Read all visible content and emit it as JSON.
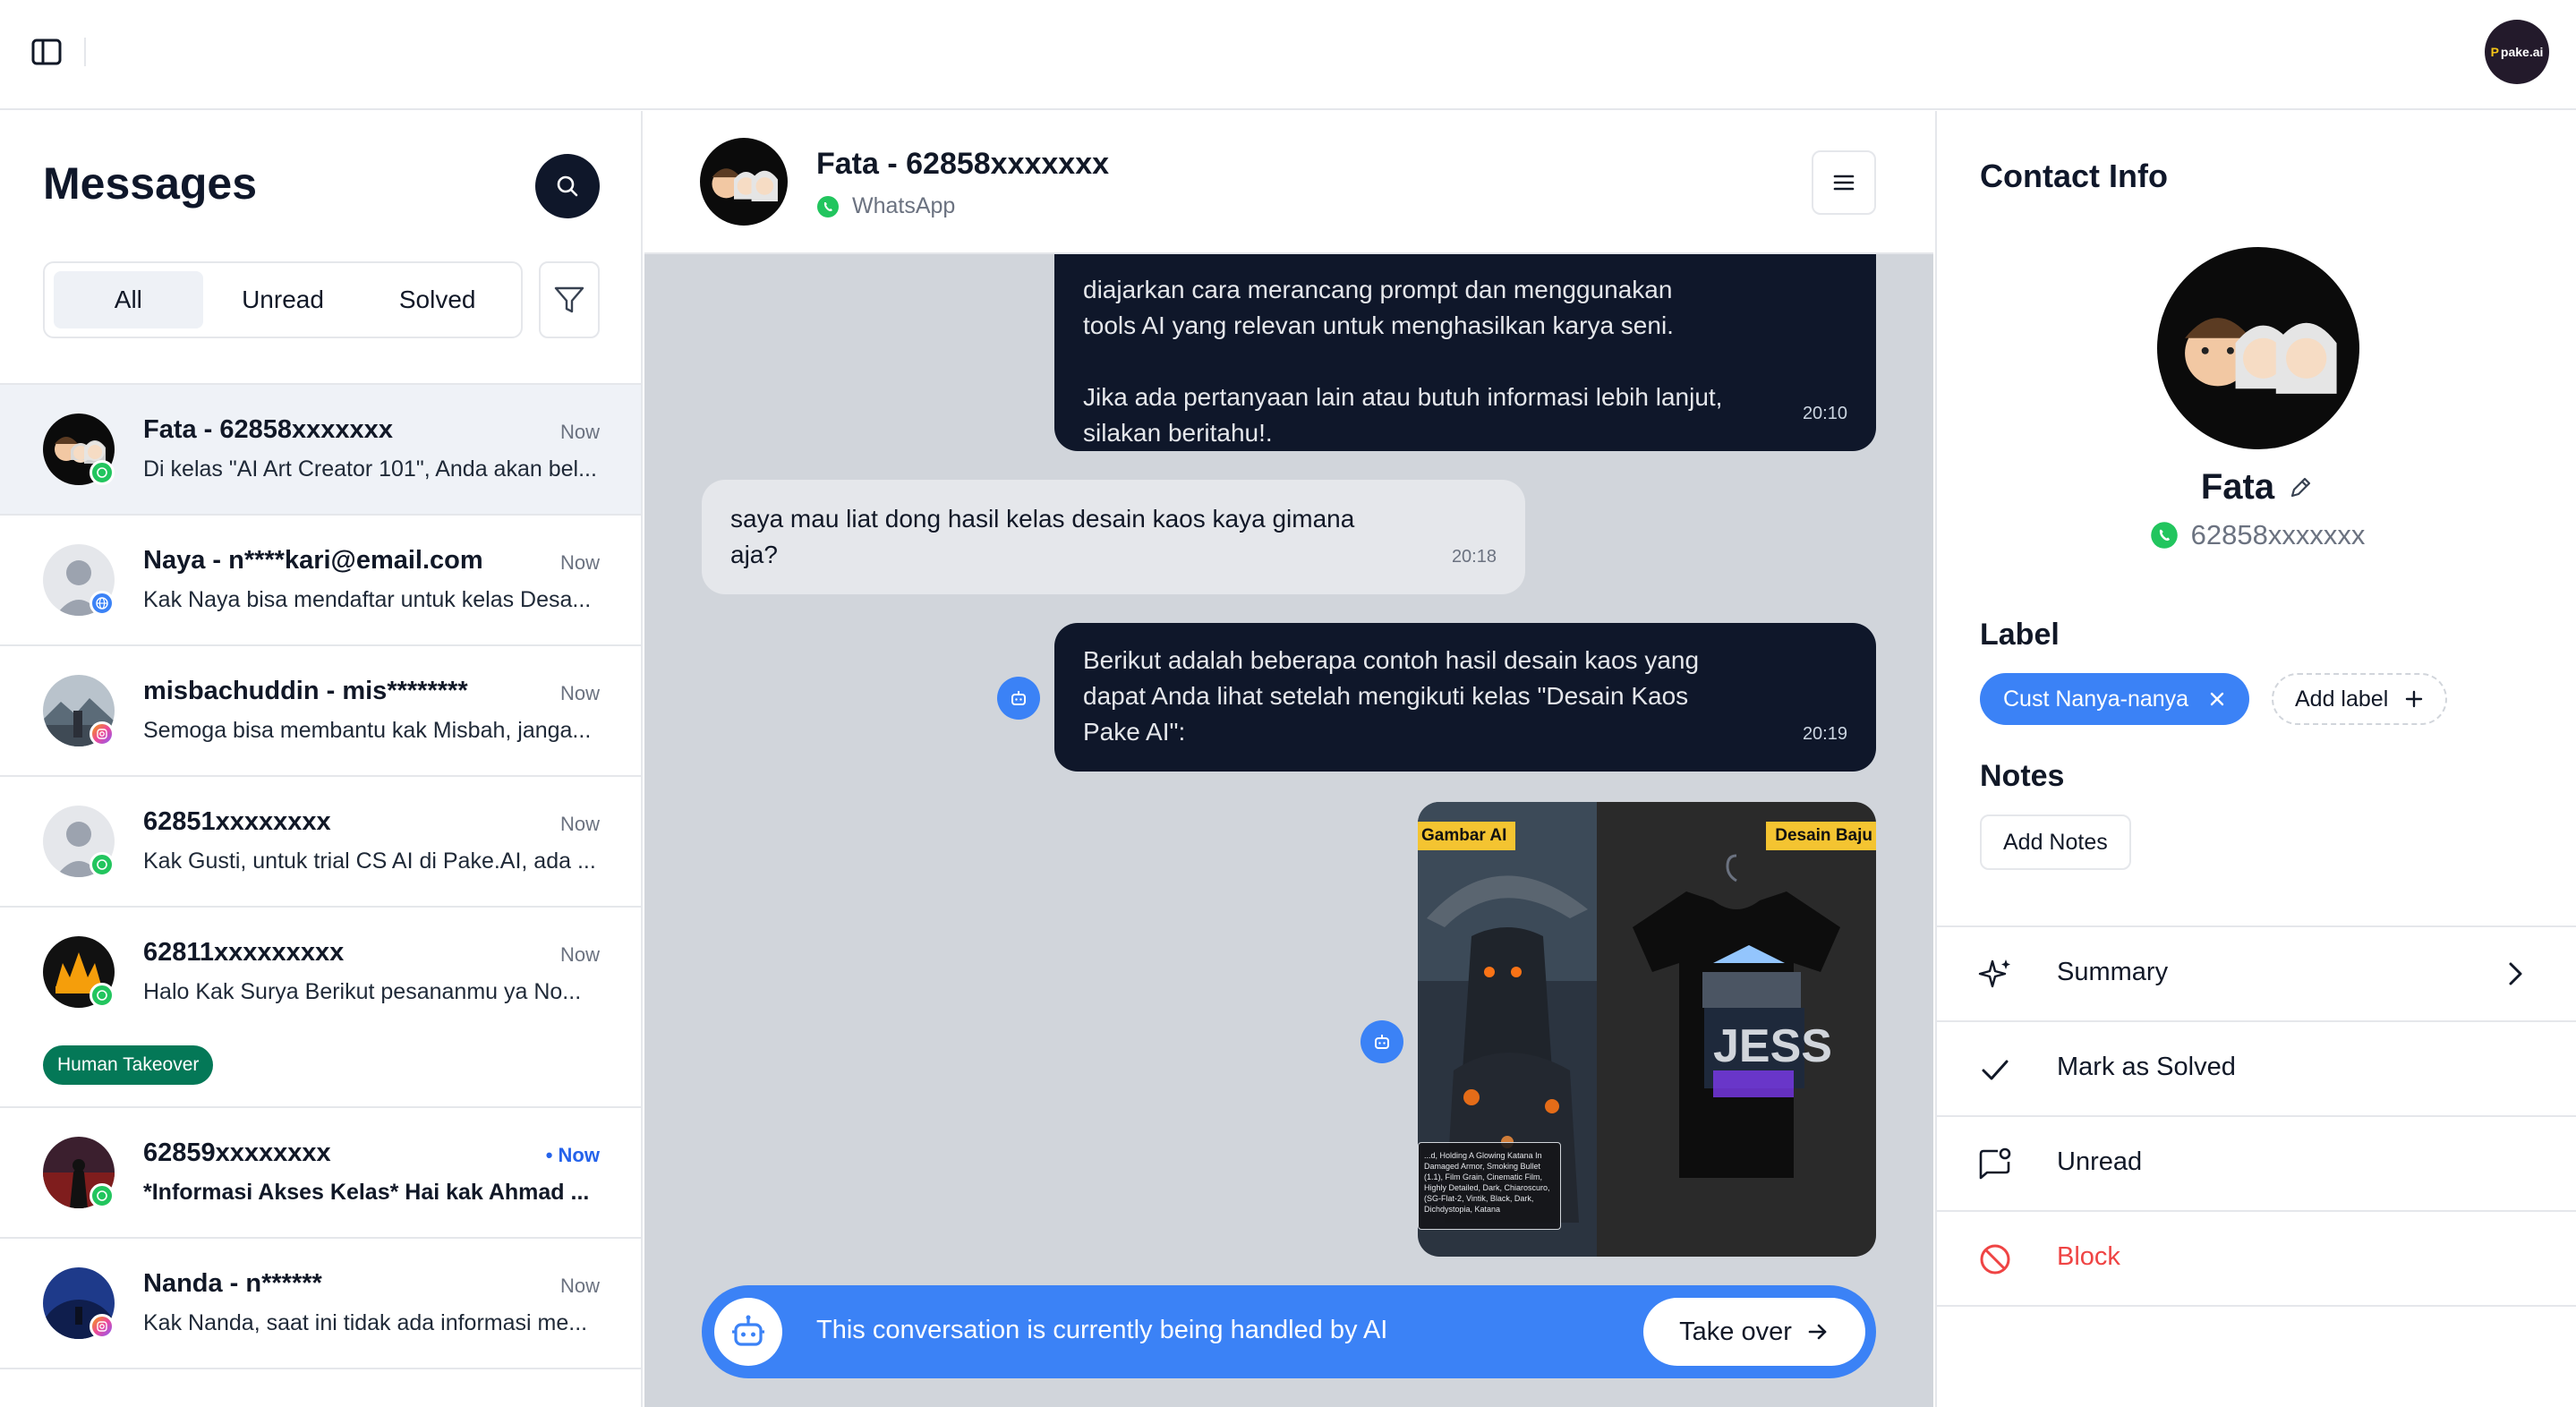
{
  "topbar": {
    "brand_text": "pake.ai",
    "brand_mark": "P"
  },
  "messages": {
    "title": "Messages",
    "tabs": [
      {
        "label": "All",
        "active": true
      },
      {
        "label": "Unread",
        "active": false
      },
      {
        "label": "Solved",
        "active": false
      }
    ],
    "conversations": [
      {
        "name": "Fata - 62858xxxxxxx",
        "time": "Now",
        "preview": "Di kelas \"AI Art Creator 101\", Anda akan bel...",
        "channel": "whatsapp",
        "selected": true,
        "unread": false
      },
      {
        "name": "Naya - n****kari@email.com",
        "time": "Now",
        "preview": "Kak Naya bisa mendaftar untuk kelas Desa...",
        "channel": "web",
        "selected": false,
        "unread": false
      },
      {
        "name": "misbachuddin - mis********",
        "time": "Now",
        "preview": "Semoga bisa membantu kak Misbah, janga...",
        "channel": "instagram",
        "selected": false,
        "unread": false
      },
      {
        "name": "62851xxxxxxxx",
        "time": "Now",
        "preview": "Kak Gusti, untuk trial CS AI di Pake.AI, ada ...",
        "channel": "whatsapp",
        "selected": false,
        "unread": false
      },
      {
        "name": "62811xxxxxxxxx",
        "time": "Now",
        "preview": "Halo Kak Surya Berikut pesananmu ya No...",
        "channel": "whatsapp",
        "selected": false,
        "unread": false,
        "tag": "Human Takeover"
      },
      {
        "name": "62859xxxxxxxx",
        "time": "• Now",
        "preview": "*Informasi Akses Kelas* Hai kak Ahmad ...",
        "channel": "whatsapp",
        "selected": false,
        "unread": true
      },
      {
        "name": "Nanda - n******",
        "time": "Now",
        "preview": "Kak Nanda, saat ini tidak ada informasi me...",
        "channel": "instagram",
        "selected": false,
        "unread": false
      }
    ]
  },
  "chat": {
    "contact_name": "Fata - 62858xxxxxxx",
    "channel": "WhatsApp",
    "messages": [
      {
        "direction": "out",
        "lines": [
          "diajarkan cara merancang prompt dan menggunakan",
          "tools AI yang relevan untuk menghasilkan karya seni.",
          "",
          "Jika ada pertanyaan lain atau butuh informasi lebih lanjut,",
          "silakan beritahu!."
        ],
        "time": "20:10"
      },
      {
        "direction": "in",
        "lines": [
          "saya mau liat dong hasil kelas desain kaos kaya gimana",
          "aja?"
        ],
        "time": "20:18"
      },
      {
        "direction": "out",
        "lines": [
          "Berikut adalah beberapa contoh hasil desain kaos yang",
          "dapat Anda lihat setelah mengikuti kelas \"Desain Kaos",
          "Pake AI\":"
        ],
        "time": "20:19"
      }
    ],
    "image": {
      "label_left": "Gambar AI",
      "label_right": "Desain Baju",
      "caption": "...d, Holding A Glowing Katana In Damaged Armor, Smoking Bullet (1.1), Film Grain, Cinematic Film, Highly Detailed, Dark, Chiaroscuro, (SG-Flat-2, Vintik, Black, Dark, Dichdystopia, Katana"
    },
    "ai_banner": {
      "text": "This conversation is currently being handled by AI",
      "button": "Take over"
    }
  },
  "contact": {
    "title": "Contact Info",
    "name": "Fata",
    "phone": "62858xxxxxxx",
    "label_title": "Label",
    "labels": [
      "Cust Nanya-nanya"
    ],
    "add_label": "Add label",
    "notes_title": "Notes",
    "add_notes": "Add Notes",
    "actions": [
      {
        "label": "Summary",
        "icon": "sparkles-icon"
      },
      {
        "label": "Mark as Solved",
        "icon": "check-icon"
      },
      {
        "label": "Unread",
        "icon": "message-dot-icon"
      },
      {
        "label": "Block",
        "icon": "block-icon"
      }
    ]
  },
  "colors": {
    "primary": "#3b82f6",
    "dark": "#0f172a",
    "whatsapp": "#22c55e",
    "danger": "#ef4444",
    "human_takeover": "#047857"
  }
}
